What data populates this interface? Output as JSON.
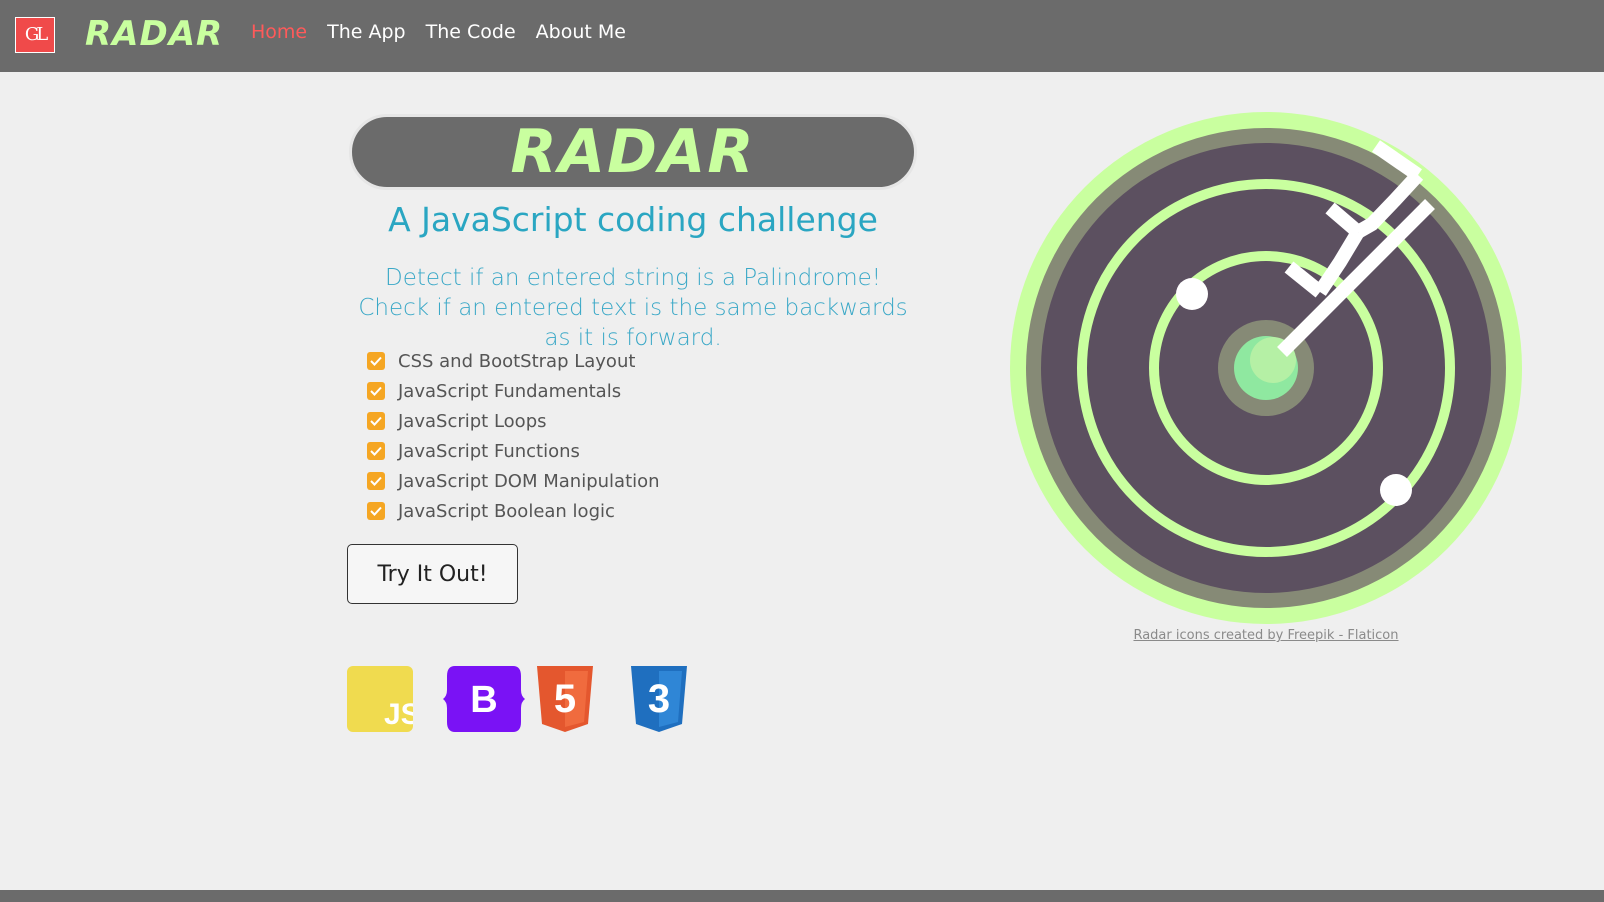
{
  "navbar": {
    "logo_text": "GL",
    "brand": "RADAR",
    "links": [
      {
        "label": "Home",
        "active": true
      },
      {
        "label": "The App",
        "active": false
      },
      {
        "label": "The Code",
        "active": false
      },
      {
        "label": "About Me",
        "active": false
      }
    ]
  },
  "hero": {
    "title": "RADAR",
    "subtitle": "A JavaScript coding challenge",
    "description": "Detect if an entered string is a Palindrome! Check if an entered text is the same backwards as it is forward."
  },
  "features": [
    "CSS and BootStrap Layout",
    "JavaScript Fundamentals",
    "JavaScript Loops",
    "JavaScript Functions",
    "JavaScript DOM Manipulation",
    "JavaScript Boolean logic"
  ],
  "cta": {
    "label": "Try It Out!"
  },
  "tech_icons": [
    {
      "name": "javascript-icon",
      "text": "JS",
      "color": "#f0db4f"
    },
    {
      "name": "bootstrap-icon",
      "text": "B",
      "color": "#7a12f5"
    },
    {
      "name": "html5-icon",
      "text": "5",
      "color": "#e4572e"
    },
    {
      "name": "css3-icon",
      "text": "3",
      "color": "#1f6fbf"
    }
  ],
  "radar_credit": "Radar icons created by Freepik - Flaticon",
  "colors": {
    "navbar_bg": "#6b6b6b",
    "brand_green": "#c9ff9f",
    "accent_red": "#ff5a5a",
    "subtitle_blue": "#2aa6c2",
    "check_orange": "#f5a623",
    "radar_dark": "#5c5060"
  }
}
